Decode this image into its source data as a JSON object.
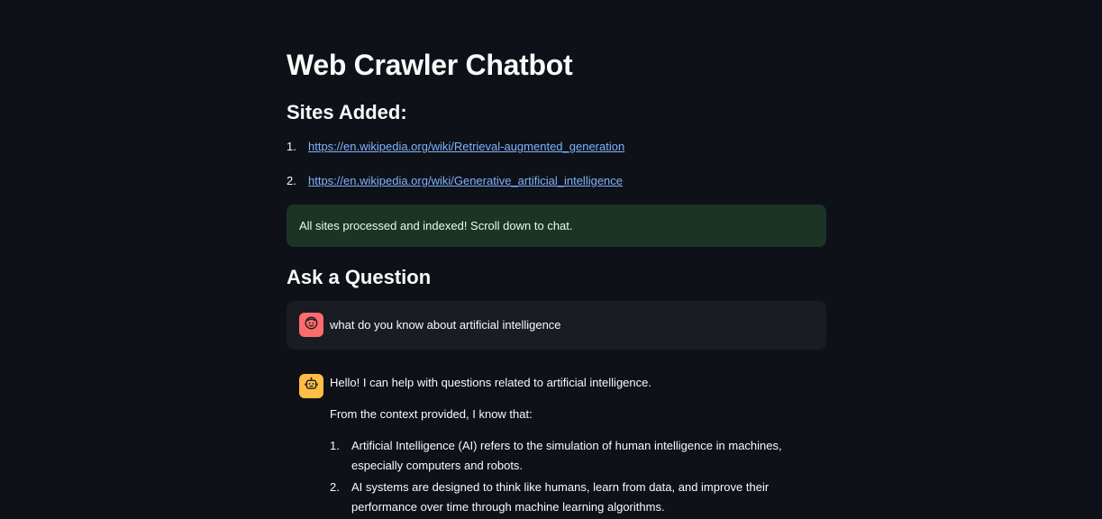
{
  "page": {
    "title": "Web Crawler Chatbot"
  },
  "sites": {
    "heading": "Sites Added:",
    "items": [
      {
        "num": "1.",
        "url": "https://en.wikipedia.org/wiki/Retrieval-augmented_generation"
      },
      {
        "num": "2.",
        "url": "https://en.wikipedia.org/wiki/Generative_artificial_intelligence"
      }
    ]
  },
  "status": {
    "message": "All sites processed and indexed! Scroll down to chat."
  },
  "chat": {
    "heading": "Ask a Question",
    "user_message": "what do you know about artificial intelligence",
    "assistant": {
      "greeting": "Hello! I can help with questions related to artificial intelligence.",
      "intro": "From the context provided, I know that:",
      "points": [
        {
          "num": "1.",
          "text": "Artificial Intelligence (AI) refers to the simulation of human intelligence in machines, especially computers and robots."
        },
        {
          "num": "2.",
          "text": "AI systems are designed to think like humans, learn from data, and improve their performance over time through machine learning algorithms."
        }
      ]
    }
  },
  "icons": {
    "user_avatar": "smiley-face-icon",
    "assistant_avatar": "robot-face-icon"
  },
  "colors": {
    "background": "#0e1117",
    "link": "#7fb2ff",
    "success_bg": "#1c3426",
    "user_avatar": "#ff6c6c",
    "assistant_avatar": "#ffbd45"
  }
}
